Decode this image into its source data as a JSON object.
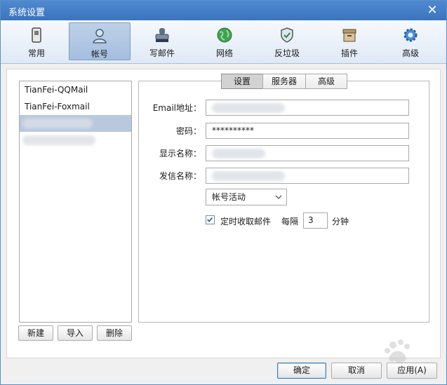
{
  "window": {
    "title": "系统设置"
  },
  "toolbar": {
    "items": [
      {
        "label": "常用",
        "icon": "phone-icon"
      },
      {
        "label": "帐号",
        "icon": "person-icon"
      },
      {
        "label": "写邮件",
        "icon": "stamp-icon"
      },
      {
        "label": "网络",
        "icon": "globe-icon"
      },
      {
        "label": "反垃圾",
        "icon": "shield-icon"
      },
      {
        "label": "插件",
        "icon": "box-icon"
      },
      {
        "label": "高级",
        "icon": "gear-icon"
      }
    ],
    "active": "帐号"
  },
  "accounts": {
    "items": [
      "TianFei-QQMail",
      "TianFei-Foxmail"
    ],
    "selected_index": 2
  },
  "list_buttons": {
    "new": "新建",
    "import": "导入",
    "delete": "删除"
  },
  "tabs": {
    "items": [
      "设置",
      "服务器",
      "高级"
    ],
    "active": "设置"
  },
  "form": {
    "email_label": "Email地址：",
    "password_label": "密码：",
    "password_value": "**********",
    "display_name_label": "显示名称：",
    "sender_name_label": "发信名称：",
    "status_select": "帐号活动",
    "auto_fetch_label": "定时收取邮件",
    "auto_fetch_checked": true,
    "interval_prefix": "每隔",
    "interval_value": "3",
    "interval_unit": "分钟"
  },
  "footer": {
    "ok": "确定",
    "cancel": "取消",
    "apply": "应用(A)"
  },
  "colors": {
    "titlebar": "#3a74bd",
    "active_tool": "#a6bfdf",
    "selected_item": "#b9c9dd"
  }
}
